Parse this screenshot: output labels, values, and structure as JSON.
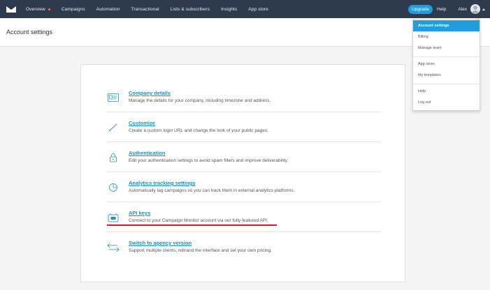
{
  "nav": {
    "items": [
      "Overview",
      "Campaigns",
      "Automation",
      "Transactional",
      "Lists & subscribers",
      "Insights",
      "App store"
    ],
    "upgrade": "Upgrade",
    "help": "Help",
    "user": "Alex"
  },
  "page": {
    "title": "Account settings"
  },
  "settings": [
    {
      "icon": "id-card-icon",
      "title": "Company details",
      "desc": "Manage the details for your company, including timezone and address."
    },
    {
      "icon": "brush-icon",
      "title": "Customize",
      "desc": "Create a custom login URL and change the look of your public pages."
    },
    {
      "icon": "lock-icon",
      "title": "Authentication",
      "desc": "Edit your authentication settings to avoid spam filters and improve deliverability."
    },
    {
      "icon": "pie-chart-icon",
      "title": "Analytics tracking settings",
      "desc": "Automatically tag campaigns so you can track them in external analytics platforms."
    },
    {
      "icon": "api-key-icon",
      "title": "API keys",
      "desc": "Connect to your Campaign Monitor account via our fully-featured API."
    },
    {
      "icon": "switch-arrows-icon",
      "title": "Switch to agency version",
      "desc": "Support multiple clients, rebrand the interface and set your own pricing."
    }
  ],
  "dropdown": [
    "Account settings",
    "Billing",
    "Manage team",
    "App store",
    "My templates",
    "Help",
    "Log out"
  ],
  "colors": {
    "nav_bg": "#2e3b4e",
    "accent": "#1e9fdc",
    "link": "#1a8fc9",
    "highlight": "#d91b1b"
  }
}
